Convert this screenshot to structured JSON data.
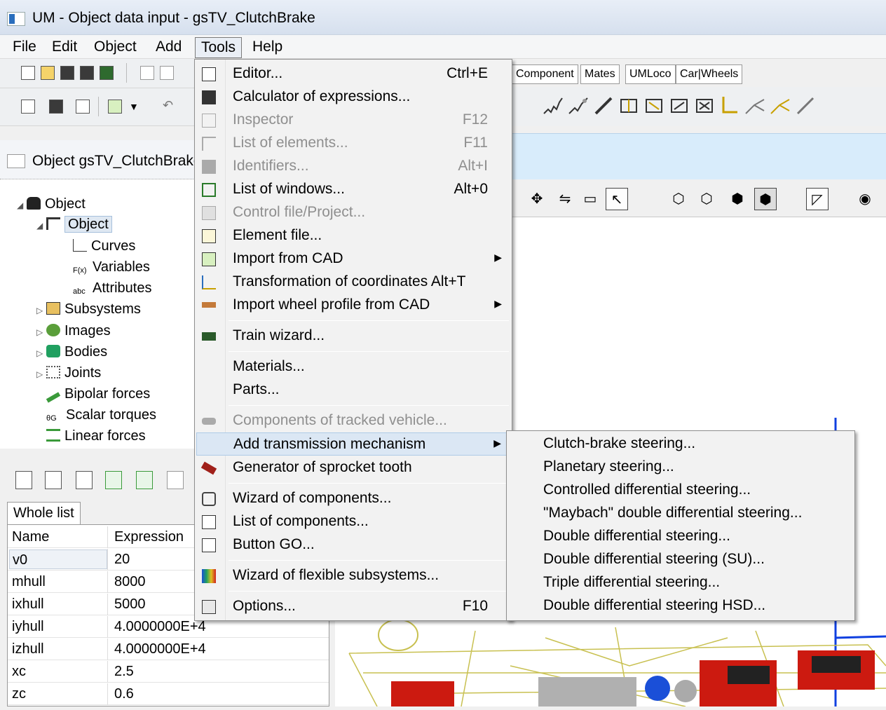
{
  "window": {
    "title": "UM - Object data input - gsTV_ClutchBrake"
  },
  "menubar": {
    "items": [
      "File",
      "Edit",
      "Object",
      "Add",
      "Tools",
      "Help"
    ],
    "active": "Tools"
  },
  "tabs": [
    "Component",
    "Mates",
    "UMLoco",
    "Car|Wheels"
  ],
  "object_panel": {
    "title": "Object gsTV_ClutchBrake",
    "tree": {
      "root": "Object",
      "object": "Object",
      "curves": "Curves",
      "variables": "Variables",
      "attributes": "Attributes",
      "subsystems": "Subsystems",
      "images": "Images",
      "bodies": "Bodies",
      "joints": "Joints",
      "bipolar_forces": "Bipolar forces",
      "scalar_torques": "Scalar torques",
      "linear_forces": "Linear forces"
    }
  },
  "variables": {
    "tab": "Whole list",
    "columns": [
      "Name",
      "Expression"
    ],
    "rows": [
      [
        "v0",
        "20"
      ],
      [
        "mhull",
        "8000"
      ],
      [
        "ixhull",
        "5000"
      ],
      [
        "iyhull",
        "4.0000000E+4"
      ],
      [
        "izhull",
        "4.0000000E+4"
      ],
      [
        "xc",
        "2.5"
      ],
      [
        "zc",
        "0.6"
      ]
    ]
  },
  "tools_menu": {
    "editor": {
      "label": "Editor...",
      "shortcut": "Ctrl+E"
    },
    "calculator": {
      "label": "Calculator of expressions..."
    },
    "inspector": {
      "label": "Inspector",
      "shortcut": "F12"
    },
    "list_elements": {
      "label": "List of elements...",
      "shortcut": "F11"
    },
    "identifiers": {
      "label": "Identifiers...",
      "shortcut": "Alt+I"
    },
    "list_windows": {
      "label": "List of windows...",
      "shortcut": "Alt+0"
    },
    "control_file": {
      "label": "Control file/Project..."
    },
    "element_file": {
      "label": "Element file..."
    },
    "import_cad": {
      "label": "Import from CAD"
    },
    "transformation": {
      "label": "Transformation of coordinates Alt+T"
    },
    "import_wheel": {
      "label": "Import wheel profile from CAD"
    },
    "train_wizard": {
      "label": "Train wizard..."
    },
    "materials": {
      "label": "Materials..."
    },
    "parts": {
      "label": "Parts..."
    },
    "tracked_components": {
      "label": "Components of tracked vehicle..."
    },
    "add_transmission": {
      "label": "Add transmission mechanism"
    },
    "sprocket_generator": {
      "label": "Generator of sprocket tooth"
    },
    "wizard_components": {
      "label": "Wizard of components..."
    },
    "list_components": {
      "label": "List of components..."
    },
    "button_go": {
      "label": "Button GO..."
    },
    "wizard_flexible": {
      "label": "Wizard of flexible subsystems..."
    },
    "options": {
      "label": "Options...",
      "shortcut": "F10"
    }
  },
  "transmission_submenu": [
    "Clutch-brake steering...",
    "Planetary steering...",
    "Controlled differential steering...",
    "\"Maybach\" double differential steering...",
    "Double differential steering...",
    "Double differential steering (SU)...",
    "Triple differential steering...",
    "Double differential steering HSD..."
  ],
  "colors": {
    "highlight": "#dbe7f4",
    "disabled_text": "#8f8f8f",
    "scene_wire": "#c8c050",
    "axis_blue": "#1040e0"
  }
}
